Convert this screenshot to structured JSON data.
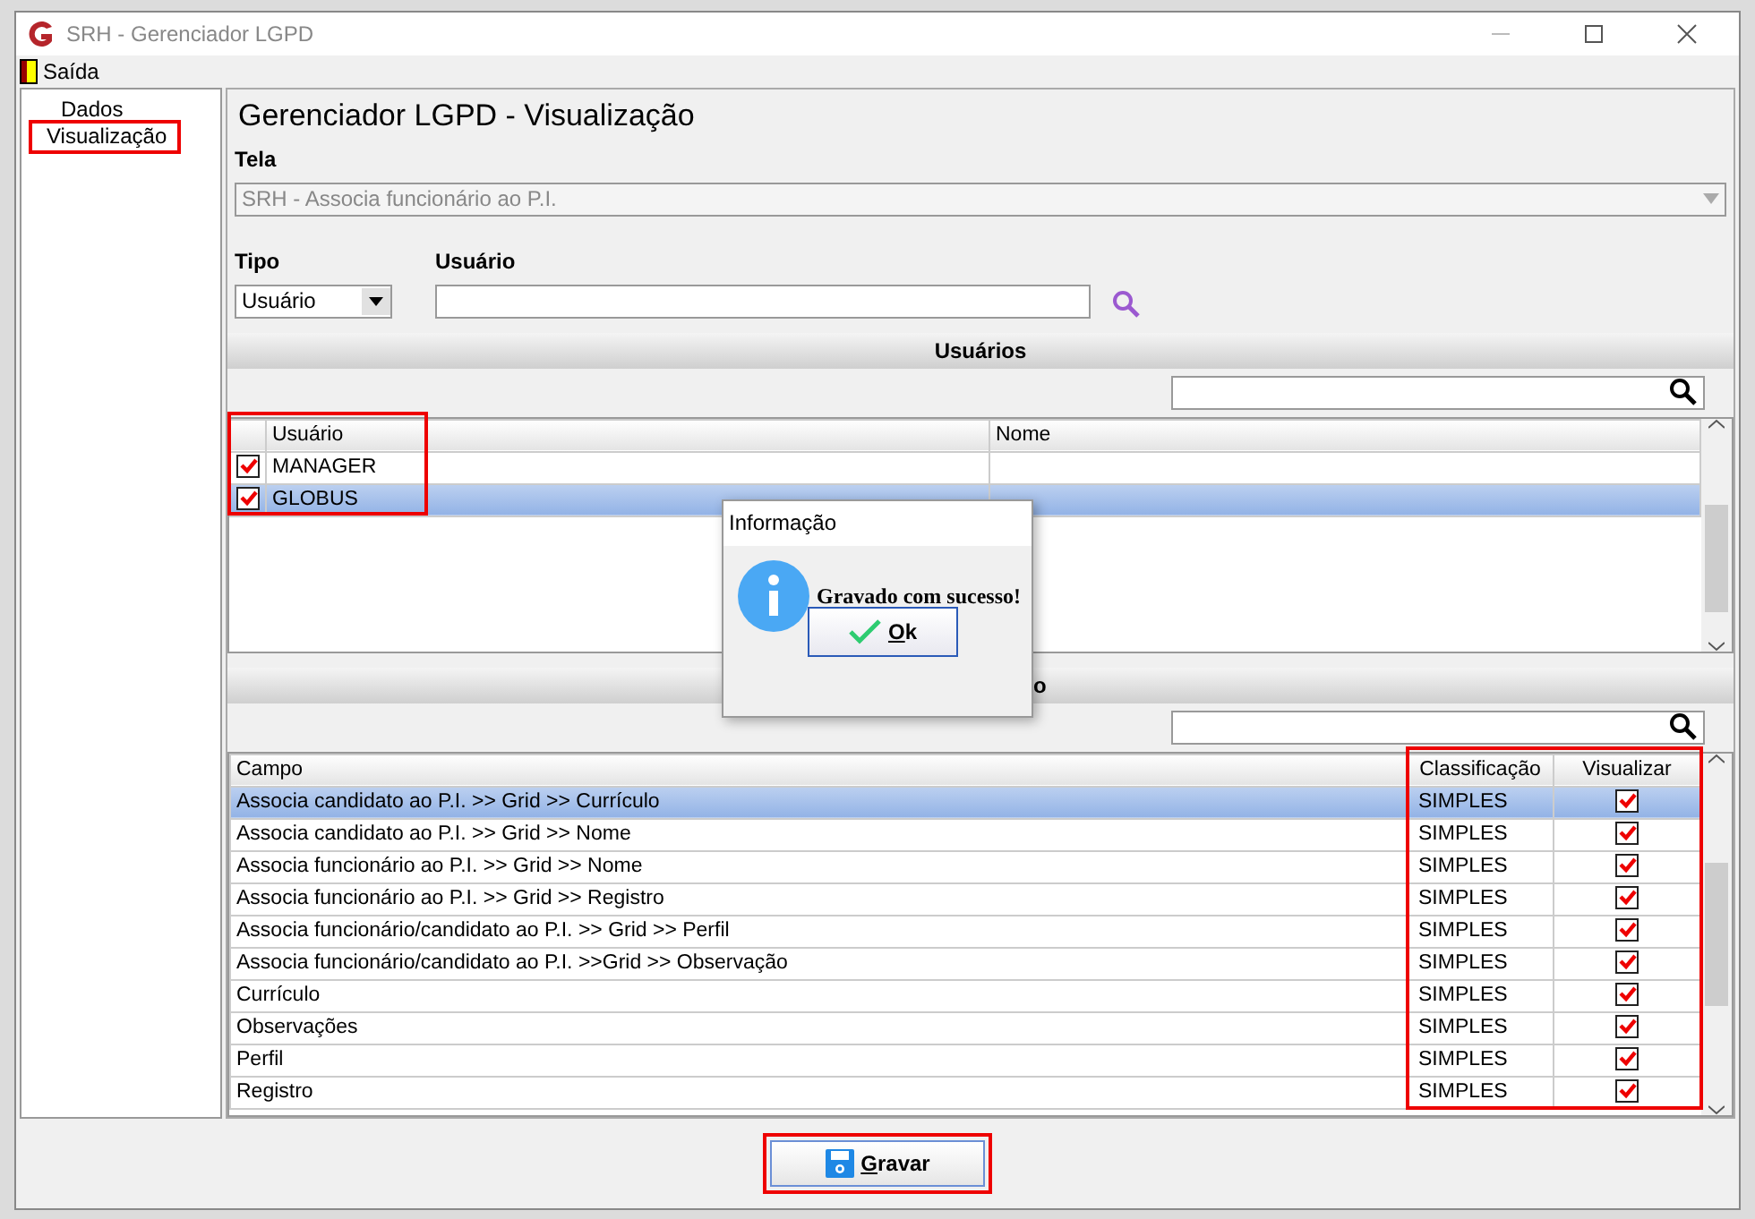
{
  "window": {
    "title": "SRH - Gerenciador LGPD"
  },
  "menu": [
    {
      "label": "Saída"
    }
  ],
  "tree": {
    "items": [
      {
        "label": "Dados",
        "selected": false
      },
      {
        "label": "Visualização",
        "selected": true
      }
    ]
  },
  "heading": "Gerenciador LGPD - Visualização",
  "tela": {
    "label": "Tela",
    "value": "SRH - Associa funcionário ao P.I.",
    "disabled": true
  },
  "tipo": {
    "label": "Tipo",
    "value": "Usuário"
  },
  "usuario": {
    "label": "Usuário"
  },
  "users_section": {
    "title": "Usuários",
    "columns": [
      "Usuário",
      "Nome"
    ],
    "rows": [
      {
        "checked": true,
        "usuario": "MANAGER",
        "nome": "",
        "selected": false
      },
      {
        "checked": true,
        "usuario": "GLOBUS",
        "nome": "",
        "selected": true
      }
    ]
  },
  "fields_section": {
    "title": "o",
    "columns": [
      "Campo",
      "Classificação",
      "Visualizar"
    ],
    "rows": [
      {
        "campo": "Associa candidato ao P.I. >> Grid >> Currículo",
        "classificacao": "SIMPLES",
        "visualizar": true,
        "selected": true
      },
      {
        "campo": "Associa candidato ao P.I. >> Grid >> Nome",
        "classificacao": "SIMPLES",
        "visualizar": true,
        "selected": false
      },
      {
        "campo": "Associa funcionário ao P.I. >> Grid >> Nome",
        "classificacao": "SIMPLES",
        "visualizar": true,
        "selected": false
      },
      {
        "campo": "Associa funcionário ao P.I. >> Grid >> Registro",
        "classificacao": "SIMPLES",
        "visualizar": true,
        "selected": false
      },
      {
        "campo": "Associa funcionário/candidato ao P.I. >> Grid >> Perfil",
        "classificacao": "SIMPLES",
        "visualizar": true,
        "selected": false
      },
      {
        "campo": "Associa funcionário/candidato ao P.I. >>Grid >> Observação",
        "classificacao": "SIMPLES",
        "visualizar": true,
        "selected": false
      },
      {
        "campo": "Currículo",
        "classificacao": "SIMPLES",
        "visualizar": true,
        "selected": false
      },
      {
        "campo": "Observações",
        "classificacao": "SIMPLES",
        "visualizar": true,
        "selected": false
      },
      {
        "campo": "Perfil",
        "classificacao": "SIMPLES",
        "visualizar": true,
        "selected": false
      },
      {
        "campo": "Registro",
        "classificacao": "SIMPLES",
        "visualizar": true,
        "selected": false
      }
    ]
  },
  "save_button": "Gravar",
  "dialog": {
    "title": "Informação",
    "message": "Gravado com sucesso!",
    "button": "Ok"
  }
}
